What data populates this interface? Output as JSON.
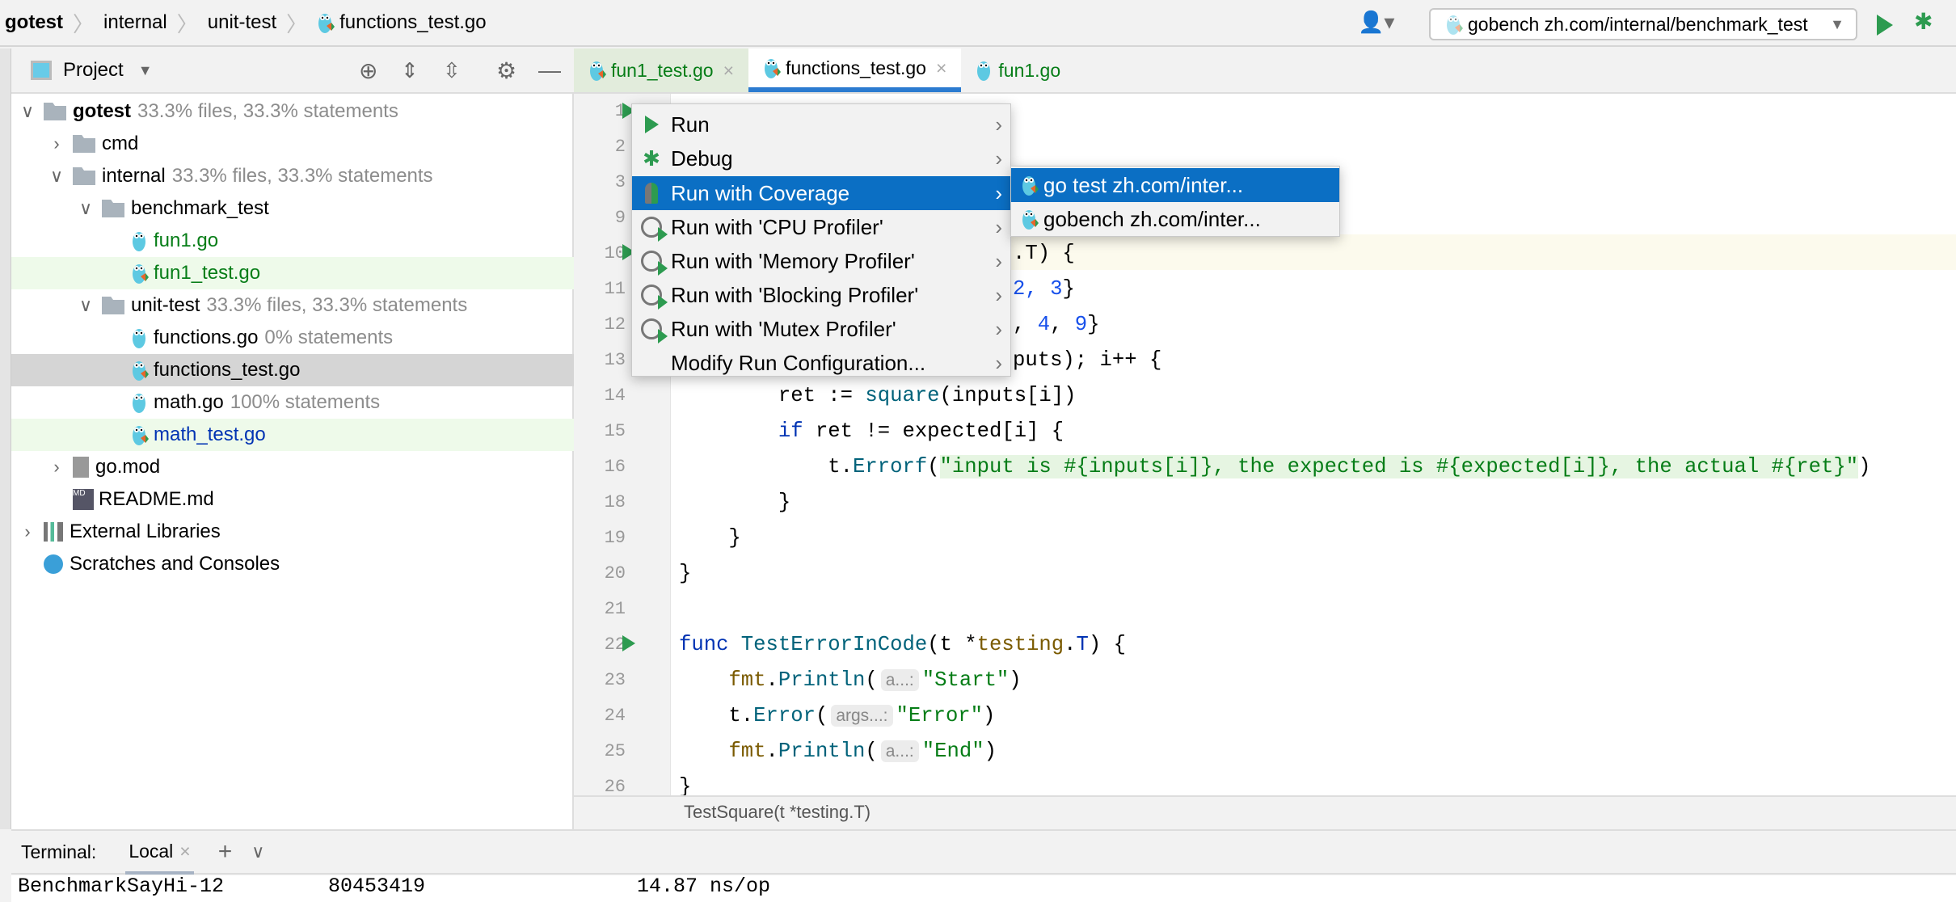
{
  "breadcrumb": [
    "gotest",
    "internal",
    "unit-test",
    "functions_test.go"
  ],
  "toolbar": {
    "run_config": "gobench zh.com/internal/benchmark_test",
    "colors": {
      "run": "#2d9b50",
      "accent": "#0b6fc4"
    }
  },
  "project_panel": {
    "title": "Project"
  },
  "tree": [
    {
      "name": "gotest",
      "extra": "33.3% files, 33.3% statements",
      "indent": 0,
      "chev": "v",
      "type": "folder",
      "bold": true
    },
    {
      "name": "cmd",
      "extra": "",
      "indent": 1,
      "chev": ">",
      "type": "folder"
    },
    {
      "name": "internal",
      "extra": "33.3% files, 33.3% statements",
      "indent": 1,
      "chev": "v",
      "type": "folder"
    },
    {
      "name": "benchmark_test",
      "extra": "",
      "indent": 2,
      "chev": "v",
      "type": "folder"
    },
    {
      "name": "fun1.go",
      "extra": "",
      "indent": 3,
      "type": "go",
      "color": "#067d17"
    },
    {
      "name": "fun1_test.go",
      "extra": "",
      "indent": 3,
      "type": "go",
      "color": "#067d17",
      "bg": "#eefaea"
    },
    {
      "name": "unit-test",
      "extra": "33.3% files, 33.3% statements",
      "indent": 2,
      "chev": "v",
      "type": "folder"
    },
    {
      "name": "functions.go",
      "extra": "0% statements",
      "indent": 3,
      "type": "go"
    },
    {
      "name": "functions_test.go",
      "extra": "",
      "indent": 3,
      "type": "go",
      "bg": "#d5d5d5"
    },
    {
      "name": "math.go",
      "extra": "100% statements",
      "indent": 3,
      "type": "go"
    },
    {
      "name": "math_test.go",
      "extra": "",
      "indent": 3,
      "type": "go",
      "color": "#0033b3",
      "bg": "#eefaea"
    },
    {
      "name": "go.mod",
      "extra": "",
      "indent": 1,
      "chev": ">",
      "type": "file"
    },
    {
      "name": "README.md",
      "extra": "",
      "indent": 1,
      "type": "md"
    },
    {
      "name": "External Libraries",
      "extra": "",
      "indent": 0,
      "chev": ">",
      "type": "lib"
    },
    {
      "name": "Scratches and Consoles",
      "extra": "",
      "indent": 0,
      "type": "scratch"
    }
  ],
  "tabs": [
    {
      "label": "fun1_test.go",
      "color": "#067d17"
    },
    {
      "label": "functions_test.go",
      "active": true
    },
    {
      "label": "fun1.go",
      "color": "#067d17"
    }
  ],
  "line_numbers": [
    "1",
    "2",
    "3",
    "9",
    "10",
    "11",
    "12",
    "13",
    "14",
    "15",
    "16",
    "18",
    "19",
    "20",
    "21",
    "22",
    "23",
    "24",
    "25",
    "26"
  ],
  "code": {
    "l10": ".T) {",
    "l11a": "2, ",
    "l11b": "3",
    "l11c": "}",
    "l12a": ", ",
    "l12b": "4",
    "l12c": ", ",
    "l12d": "9",
    "l12e": "}",
    "l13": "puts); i++ {",
    "l14a": "        ret := ",
    "l14b": "square",
    "l14c": "(inputs[i])",
    "l15a": "        ",
    "l15b": "if",
    "l15c": " ret != expected[i] {",
    "l16a": "            t.",
    "l16b": "Errorf",
    "l16c": "(",
    "l16d": "\"input is #{inputs[i]}, the expected is #{expected[i]}, the actual #{ret}\"",
    "l16e": ")",
    "l18": "        }",
    "l19": "    }",
    "l20": "}",
    "l22a": "func",
    "l22b": " ",
    "l22c": "TestErrorInCode",
    "l22d": "(t *",
    "l22e": "testing",
    "l22f": ".",
    "l22g": "T",
    "l22h": ") {",
    "l23a": "    ",
    "l23b": "fmt",
    "l23c": ".",
    "l23d": "Println",
    "l23e": "(",
    "l23hint": "a...:",
    "l23f": "\"Start\"",
    "l23g": ")",
    "l24a": "    t.",
    "l24b": "Error",
    "l24c": "(",
    "l24hint": "args...:",
    "l24f": "\"Error\"",
    "l24g": ")",
    "l25a": "    ",
    "l25b": "fmt",
    "l25c": ".",
    "l25d": "Println",
    "l25e": "(",
    "l25hint": "a...:",
    "l25f": "\"End\"",
    "l25g": ")",
    "l26": "}"
  },
  "editor_breadcrumb": "TestSquare(t *testing.T)",
  "context_menu": {
    "items": [
      {
        "label": "Run",
        "icon": "run-icon"
      },
      {
        "label": "Debug",
        "icon": "debug-icon"
      },
      {
        "label": "Run with Coverage",
        "icon": "coverage-icon",
        "selected": true
      },
      {
        "label": "Run with 'CPU Profiler'",
        "icon": "profiler-icon"
      },
      {
        "label": "Run with 'Memory Profiler'",
        "icon": "profiler-icon"
      },
      {
        "label": "Run with 'Blocking Profiler'",
        "icon": "profiler-icon"
      },
      {
        "label": "Run with 'Mutex Profiler'",
        "icon": "profiler-icon"
      },
      {
        "label": "Modify Run Configuration...",
        "icon": ""
      }
    ]
  },
  "submenu": {
    "items": [
      {
        "label": "go test zh.com/inter...",
        "selected": true
      },
      {
        "label": "gobench zh.com/inter..."
      }
    ]
  },
  "terminal": {
    "label": "Terminal:",
    "tab": "Local",
    "output": {
      "name": "BenchmarkSayHi-12",
      "count": "80453419",
      "time": "14.87 ns/op"
    }
  }
}
